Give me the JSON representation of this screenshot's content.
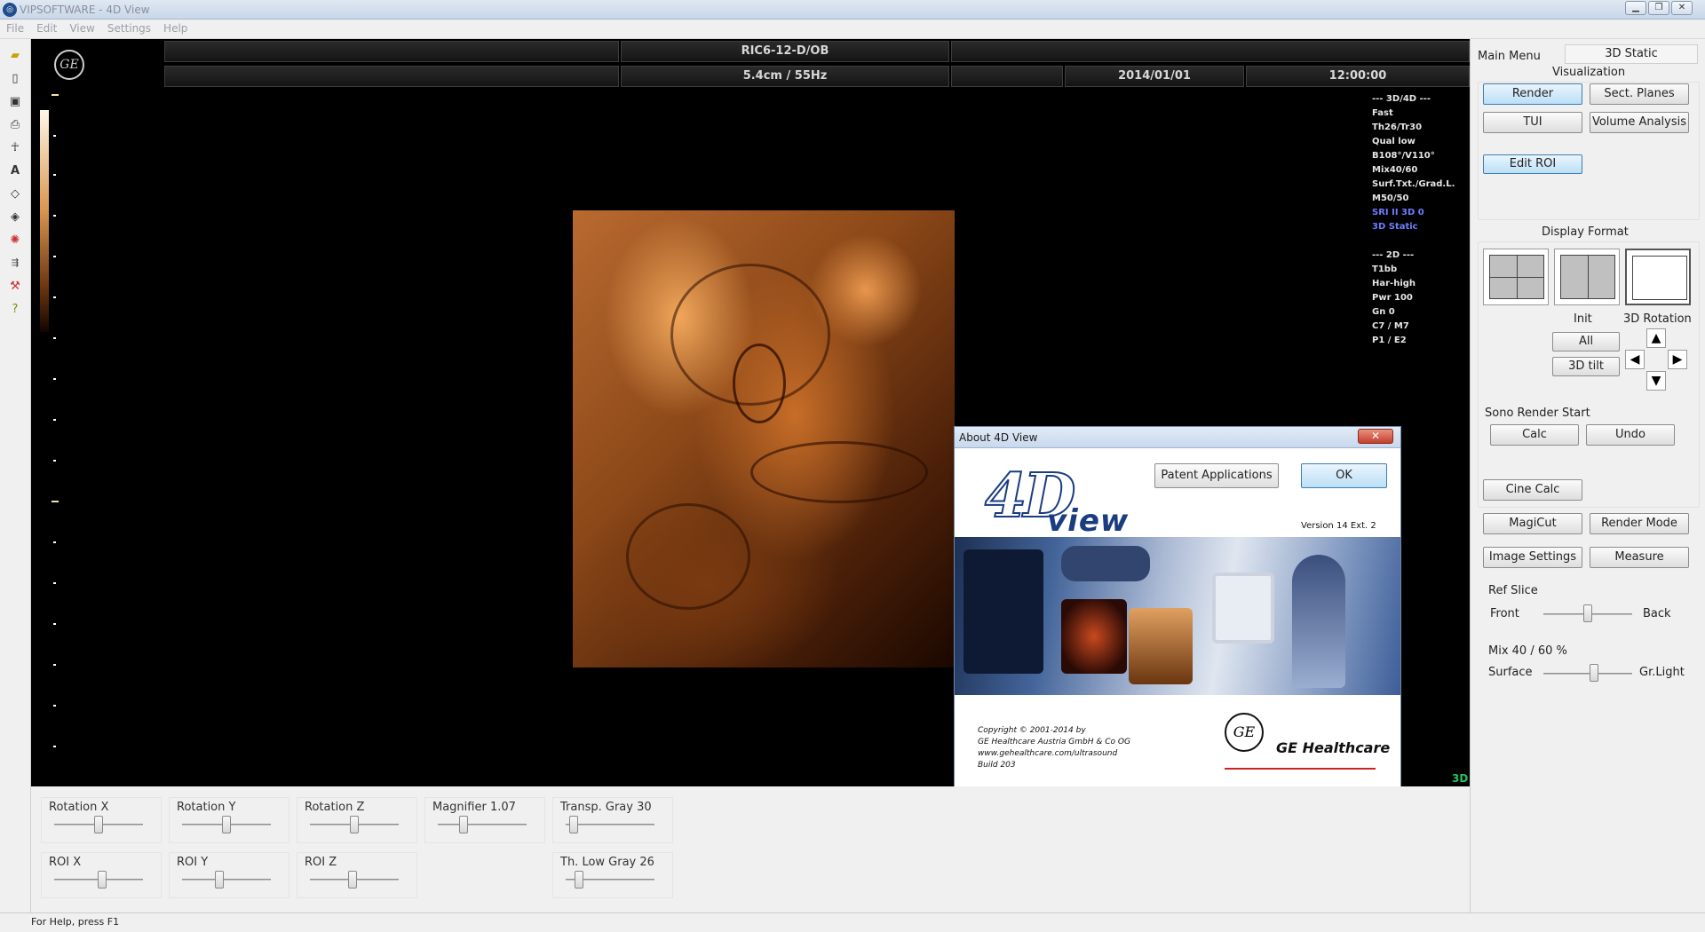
{
  "window": {
    "title": "VIPSOFTWARE - 4D View"
  },
  "menu": [
    "File",
    "Edit",
    "View",
    "Settings",
    "Help"
  ],
  "viewport": {
    "probe": "RIC6-12-D/OB",
    "depth_freq": "5.4cm / 55Hz",
    "date": "2014/01/01",
    "time": "12:00:00",
    "mode_tag": "3D",
    "info_3d": [
      "--- 3D/4D ---",
      "Fast",
      "Th26/Tr30",
      "Qual low",
      "B108°/V110°",
      "Mix40/60",
      "Surf.Txt./Grad.L.",
      "M50/50"
    ],
    "info_highlight": [
      "SRI II 3D 0",
      "3D Static"
    ],
    "info_2d": [
      "--- 2D ---",
      "T1bb",
      "Har-high",
      "Pwr 100",
      "Gn  0",
      "C7 / M7",
      "P1 / E2"
    ],
    "ge_logo": "GE"
  },
  "dialog": {
    "title": "About 4D View",
    "close": "✕",
    "patent_button": "Patent Applications",
    "ok_button": "OK",
    "logo_big": "4D",
    "logo_view": "view",
    "version": "Version 14 Ext. 2",
    "copyright": [
      "Copyright © 2001-2014 by",
      "GE Healthcare Austria GmbH & Co OG",
      "www.gehealthcare.com/ultrasound",
      "Build 203"
    ],
    "ge_text": "GE Healthcare",
    "ge_logo": "GE"
  },
  "right": {
    "main_menu": "Main Menu",
    "mode_tab": "3D Static",
    "visualization": "Visualization",
    "render": "Render",
    "sect_planes": "Sect. Planes",
    "tui": "TUI",
    "volume_analysis": "Volume Analysis",
    "edit_roi": "Edit ROI",
    "display_format": "Display Format",
    "init": "Init",
    "rotation_3d": "3D Rotation",
    "all": "All",
    "tilt": "3D tilt",
    "sono_render": "Sono Render Start",
    "calc": "Calc",
    "undo": "Undo",
    "cine_calc": "Cine Calc",
    "magicut": "MagiCut",
    "render_mode": "Render Mode",
    "image_settings": "Image Settings",
    "measure": "Measure",
    "ref_slice": "Ref Slice",
    "front": "Front",
    "back": "Back",
    "mix": "Mix 40 / 60 %",
    "surface": "Surface",
    "grlight": "Gr.Light",
    "arrows": {
      "up": "▲",
      "left": "◀",
      "right": "▶",
      "down": "▼"
    }
  },
  "bottom": {
    "rotation_x": "Rotation X",
    "rotation_y": "Rotation Y",
    "rotation_z": "Rotation Z",
    "magnifier": "Magnifier 1.07",
    "transp": "Transp. Gray 30",
    "roi_x": "ROI  X",
    "roi_y": "ROI  Y",
    "roi_z": "ROI  Z",
    "th_low": "Th. Low Gray 26"
  },
  "status": "For Help, press F1",
  "colors": {
    "accent_button": "#bcdff7",
    "info_highlight": "#6f7cff",
    "tag_3d": "#21c35a"
  }
}
